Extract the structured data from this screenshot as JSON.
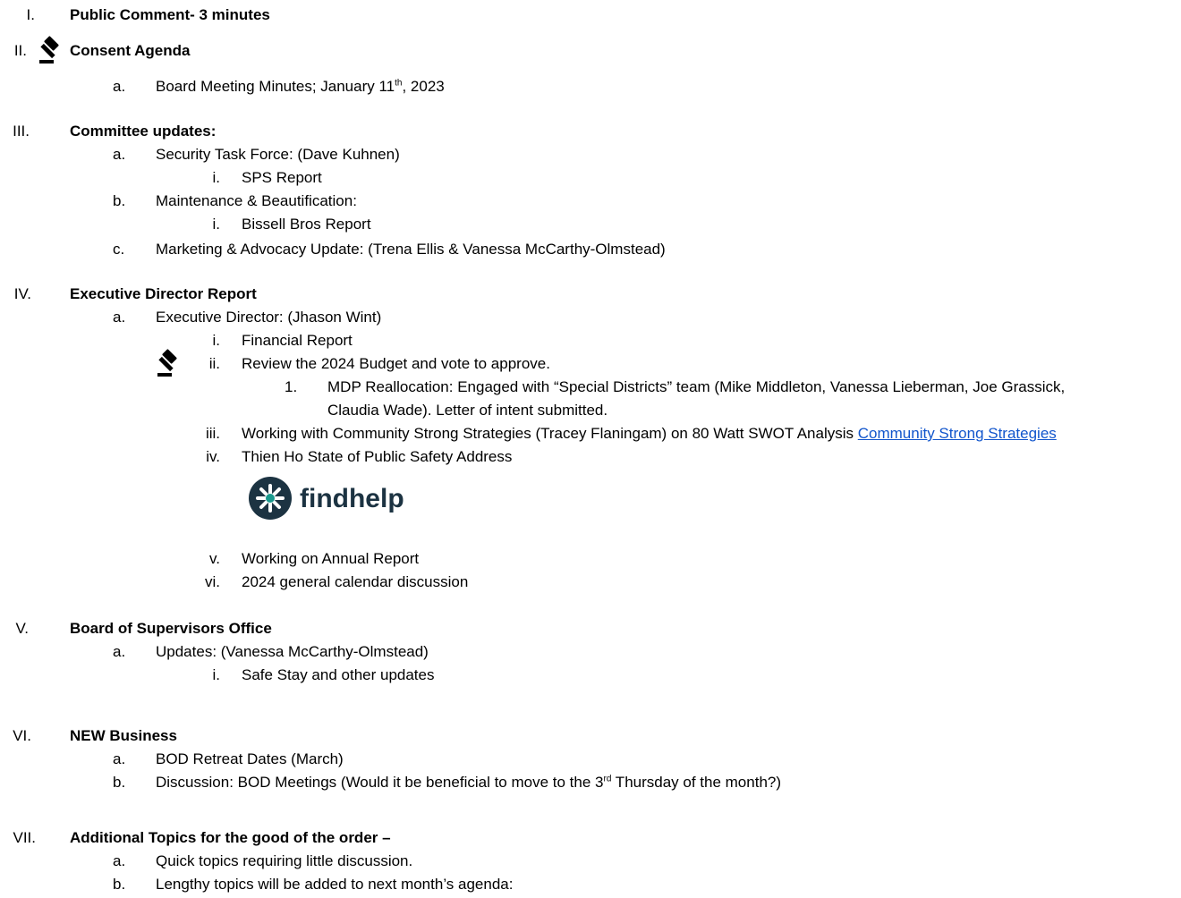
{
  "sections": {
    "s1": {
      "numeral": "I.",
      "title": "Public Comment- 3 minutes"
    },
    "s2": {
      "numeral": "II.",
      "title": "Consent Agenda",
      "a": {
        "marker": "a.",
        "pre": "Board Meeting Minutes; January 11",
        "sup": "th",
        "post": ", 2023"
      }
    },
    "s3": {
      "numeral": "III.",
      "title": "Committee updates:",
      "a": {
        "marker": "a.",
        "text": "Security Task Force: (Dave Kuhnen)"
      },
      "a_i": {
        "marker": "i.",
        "text": "SPS Report"
      },
      "b": {
        "marker": "b.",
        "text": "Maintenance & Beautification:"
      },
      "b_i": {
        "marker": "i.",
        "text": "Bissell Bros Report"
      },
      "c": {
        "marker": "c.",
        "text": "Marketing & Advocacy Update: (Trena Ellis & Vanessa McCarthy-Olmstead)"
      }
    },
    "s4": {
      "numeral": "IV.",
      "title": "Executive Director Report",
      "a": {
        "marker": "a.",
        "text": "Executive Director: (Jhason Wint)"
      },
      "i": {
        "marker": "i.",
        "text": "Financial Report"
      },
      "ii": {
        "marker": "ii.",
        "text": "Review the 2024 Budget and vote to approve."
      },
      "ii_1": {
        "marker": "1.",
        "line1": "MDP Reallocation: Engaged with “Special Districts” team (Mike Middleton, Vanessa Lieberman, Joe Grassick,",
        "line2": "Claudia Wade). Letter of intent submitted."
      },
      "iii": {
        "marker": "iii.",
        "text": "Working with Community Strong Strategies (Tracey Flaningam) on 80 Watt SWOT Analysis ",
        "link": "Community Strong Strategies"
      },
      "iv": {
        "marker": "iv.",
        "text": "Thien Ho State of Public Safety Address"
      },
      "logo_text": "findhelp",
      "v": {
        "marker": "v.",
        "text": "Working on Annual Report"
      },
      "vi": {
        "marker": "vi.",
        "text": "2024 general calendar discussion"
      }
    },
    "s5": {
      "numeral": "V.",
      "title": "Board of Supervisors Office",
      "a": {
        "marker": "a.",
        "text": "Updates: (Vanessa McCarthy-Olmstead)"
      },
      "a_i": {
        "marker": "i.",
        "text": "Safe Stay and other updates"
      }
    },
    "s6": {
      "numeral": "VI.",
      "title": "NEW Business",
      "a": {
        "marker": "a.",
        "text": "BOD Retreat Dates (March)"
      },
      "b": {
        "marker": "b.",
        "pre": "Discussion: BOD Meetings (Would it be beneficial to move to the 3",
        "sup": "rd",
        "post": " Thursday of the month?)"
      }
    },
    "s7": {
      "numeral": "VII.",
      "title": "Additional Topics for the good of the order –",
      "a": {
        "marker": "a.",
        "text": "Quick topics requiring little discussion."
      },
      "b": {
        "marker": "b.",
        "text": "Lengthy topics will be added to next month’s agenda:"
      }
    }
  },
  "icons": {
    "gavel": "gavel-icon",
    "logo": "findhelp-logo"
  },
  "colors": {
    "link": "#1155cc",
    "logo_dark": "#1c3342",
    "logo_accent": "#1a9a8e"
  }
}
